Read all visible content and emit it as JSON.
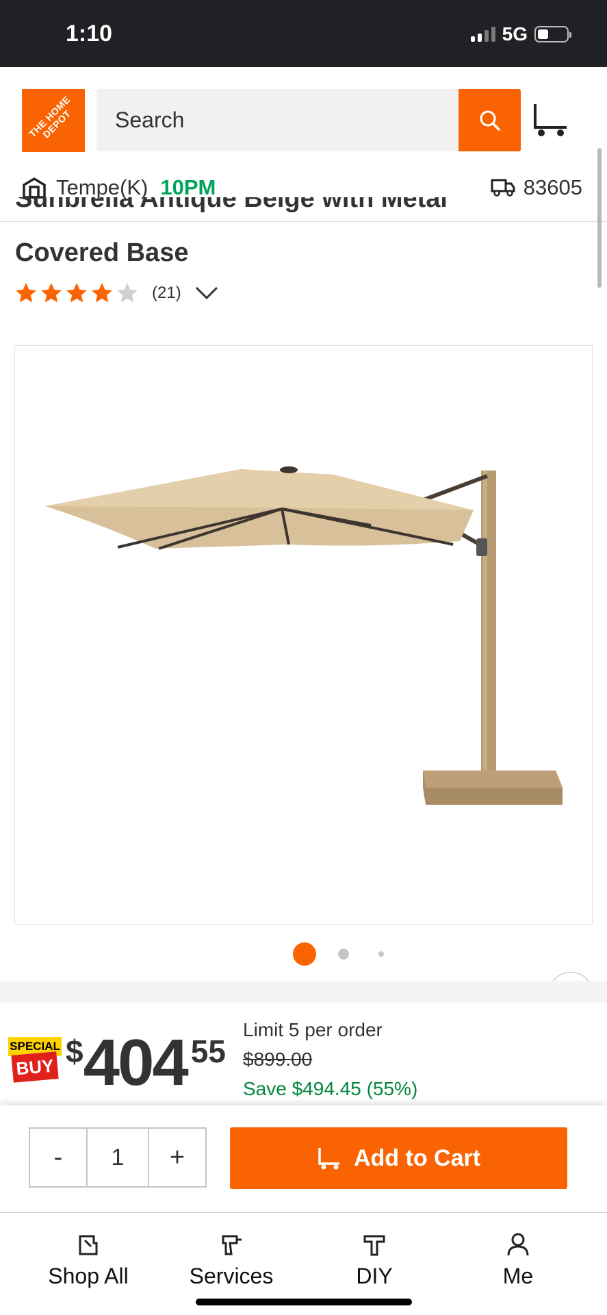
{
  "status_bar": {
    "time": "1:10",
    "network": "5G"
  },
  "header": {
    "logo_text": "THE HOME DEPOT",
    "search_placeholder": "Search",
    "store_name": "Tempe(K)",
    "store_hours": "10PM",
    "zip_code": "83605"
  },
  "product": {
    "title_line1": "Sunbrella Antique Beige with Metal",
    "title_line2": "Covered Base",
    "rating_stars": 4,
    "rating_max": 5,
    "review_count": "(21)",
    "image_count": 3,
    "active_image": 0
  },
  "pricing": {
    "badge_top": "SPECIAL",
    "badge_bottom": "BUY",
    "currency": "$",
    "dollars": "404",
    "cents": "55",
    "limit": "Limit 5 per order",
    "was_price": "$899.00",
    "savings": "Save $494.45 (55%)"
  },
  "cart": {
    "minus_label": "-",
    "quantity": "1",
    "plus_label": "+",
    "add_label": "Add to Cart"
  },
  "bottom_nav": [
    {
      "label": "Shop All",
      "icon": "shop-all-icon"
    },
    {
      "label": "Services",
      "icon": "services-drill-icon"
    },
    {
      "label": "DIY",
      "icon": "diy-hammer-icon"
    },
    {
      "label": "Me",
      "icon": "me-person-icon"
    }
  ],
  "colors": {
    "brand_orange": "#f96302",
    "store_green": "#00a35b",
    "save_green": "#00873c"
  }
}
